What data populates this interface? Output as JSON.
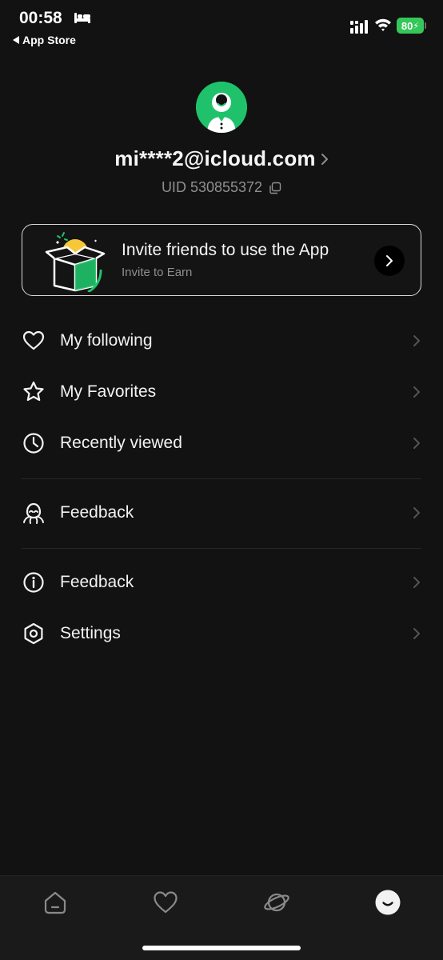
{
  "status_bar": {
    "time": "00:58",
    "back_app_label": "App Store",
    "battery_level": "80",
    "battery_color": "#35c759"
  },
  "profile": {
    "email": "mi****2@icloud.com",
    "uid": "UID 530855372",
    "avatar_color": "#1fc26a"
  },
  "invite": {
    "title": "Invite friends to use the App",
    "subtitle": "Invite to Earn"
  },
  "menu": {
    "items": [
      {
        "label": "My following",
        "icon": "heart-icon"
      },
      {
        "label": "My Favorites",
        "icon": "star-icon"
      },
      {
        "label": "Recently viewed",
        "icon": "clock-icon"
      },
      {
        "label": "Feedback",
        "icon": "support-icon"
      },
      {
        "label": "Feedback",
        "icon": "info-icon"
      },
      {
        "label": "Settings",
        "icon": "settings-icon"
      }
    ]
  },
  "tab_bar": {
    "tabs": [
      {
        "icon": "home-icon",
        "active": false
      },
      {
        "icon": "heart-icon",
        "active": false
      },
      {
        "icon": "planet-icon",
        "active": false
      },
      {
        "icon": "profile-smile-icon",
        "active": true
      }
    ]
  }
}
